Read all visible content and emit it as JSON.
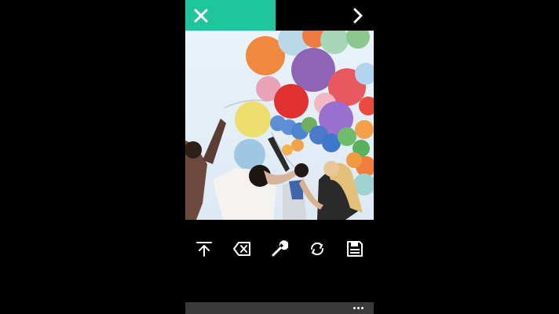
{
  "colors": {
    "accent": "#1fc59b",
    "background": "#000000",
    "appbar": "#3a3a3a",
    "icon": "#ffffff"
  },
  "header": {
    "close_icon": "close-icon",
    "next_icon": "chevron-right-icon"
  },
  "photo": {
    "content": "photo-balloons-party"
  },
  "toolbar": {
    "items": [
      {
        "icon": "share-upload-icon"
      },
      {
        "icon": "backspace-clear-icon"
      },
      {
        "icon": "wrench-icon"
      },
      {
        "icon": "rotate-icon"
      },
      {
        "icon": "save-icon"
      }
    ]
  },
  "appbar": {
    "more_icon": "more-ellipsis-icon"
  }
}
